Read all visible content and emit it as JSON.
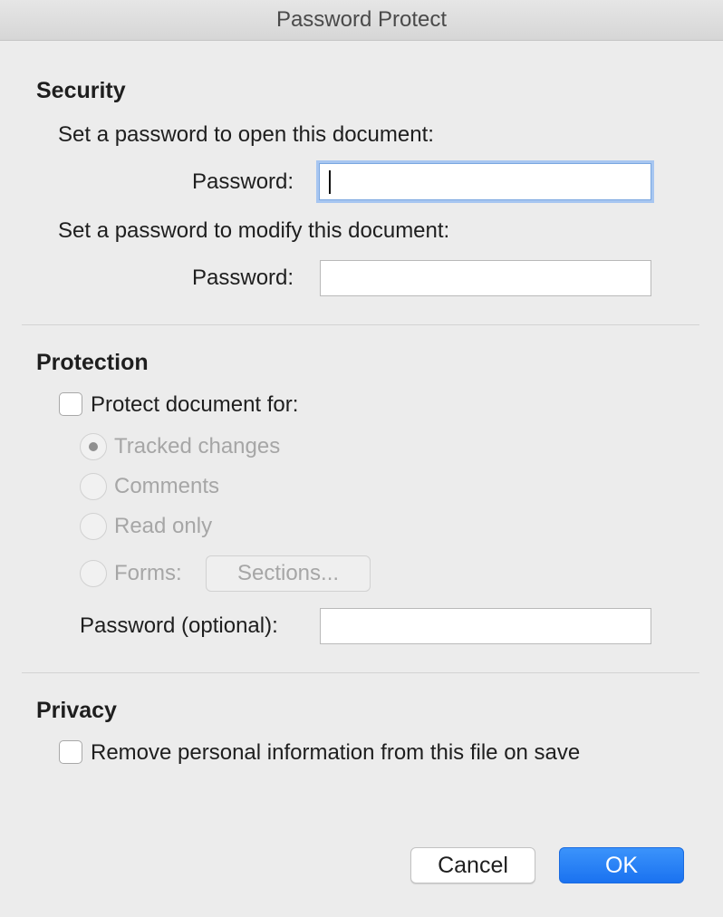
{
  "window": {
    "title": "Password Protect"
  },
  "security": {
    "heading": "Security",
    "open_prompt": "Set a password to open this document:",
    "open_password_label": "Password:",
    "open_password_value": "",
    "modify_prompt": "Set a password to modify this document:",
    "modify_password_label": "Password:",
    "modify_password_value": ""
  },
  "protection": {
    "heading": "Protection",
    "protect_checkbox_label": "Protect document for:",
    "protect_checked": false,
    "options": [
      {
        "label": "Tracked changes",
        "selected": true
      },
      {
        "label": "Comments",
        "selected": false
      },
      {
        "label": "Read only",
        "selected": false
      },
      {
        "label": "Forms:",
        "selected": false
      }
    ],
    "sections_button_label": "Sections...",
    "optional_password_label": "Password (optional):",
    "optional_password_value": ""
  },
  "privacy": {
    "heading": "Privacy",
    "remove_info_label": "Remove personal information from this file on save",
    "remove_info_checked": false
  },
  "buttons": {
    "cancel_label": "Cancel",
    "ok_label": "OK"
  },
  "colors": {
    "accent": "#1a72f0",
    "background": "#ececec",
    "disabled_text": "#a6a6a6"
  }
}
